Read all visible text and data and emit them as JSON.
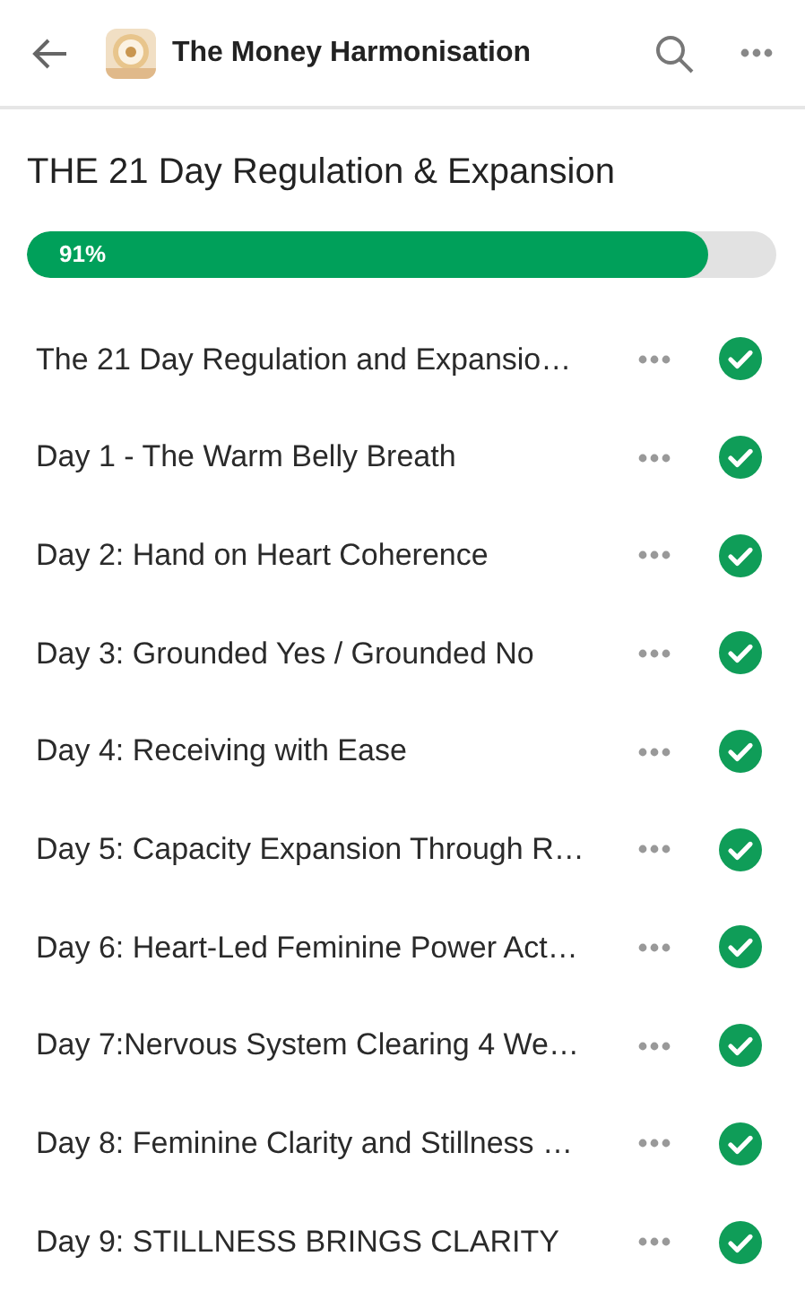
{
  "header": {
    "title": "The Money Harmonisation"
  },
  "course": {
    "title": "THE 21 Day Regulation & Expansion",
    "progress": {
      "label": "91%",
      "level": 0.91
    }
  },
  "lessons": [
    {
      "title": "The 21 Day Regulation and Expansio…",
      "completed": true
    },
    {
      "title": "Day 1 - The Warm Belly Breath",
      "completed": true
    },
    {
      "title": "Day 2: Hand on Heart Coherence",
      "completed": true
    },
    {
      "title": "Day 3: Grounded Yes / Grounded No",
      "completed": true
    },
    {
      "title": "Day 4: Receiving with Ease",
      "completed": true
    },
    {
      "title": "Day 5: Capacity Expansion Through R…",
      "completed": true
    },
    {
      "title": "Day 6: Heart-Led Feminine Power Act…",
      "completed": true
    },
    {
      "title": "Day 7:Nervous System Clearing 4 We…",
      "completed": true
    },
    {
      "title": "Day 8: Feminine Clarity and Stillness …",
      "completed": true
    },
    {
      "title": "Day 9: STILLNESS BRINGS CLARITY",
      "completed": true
    }
  ]
}
